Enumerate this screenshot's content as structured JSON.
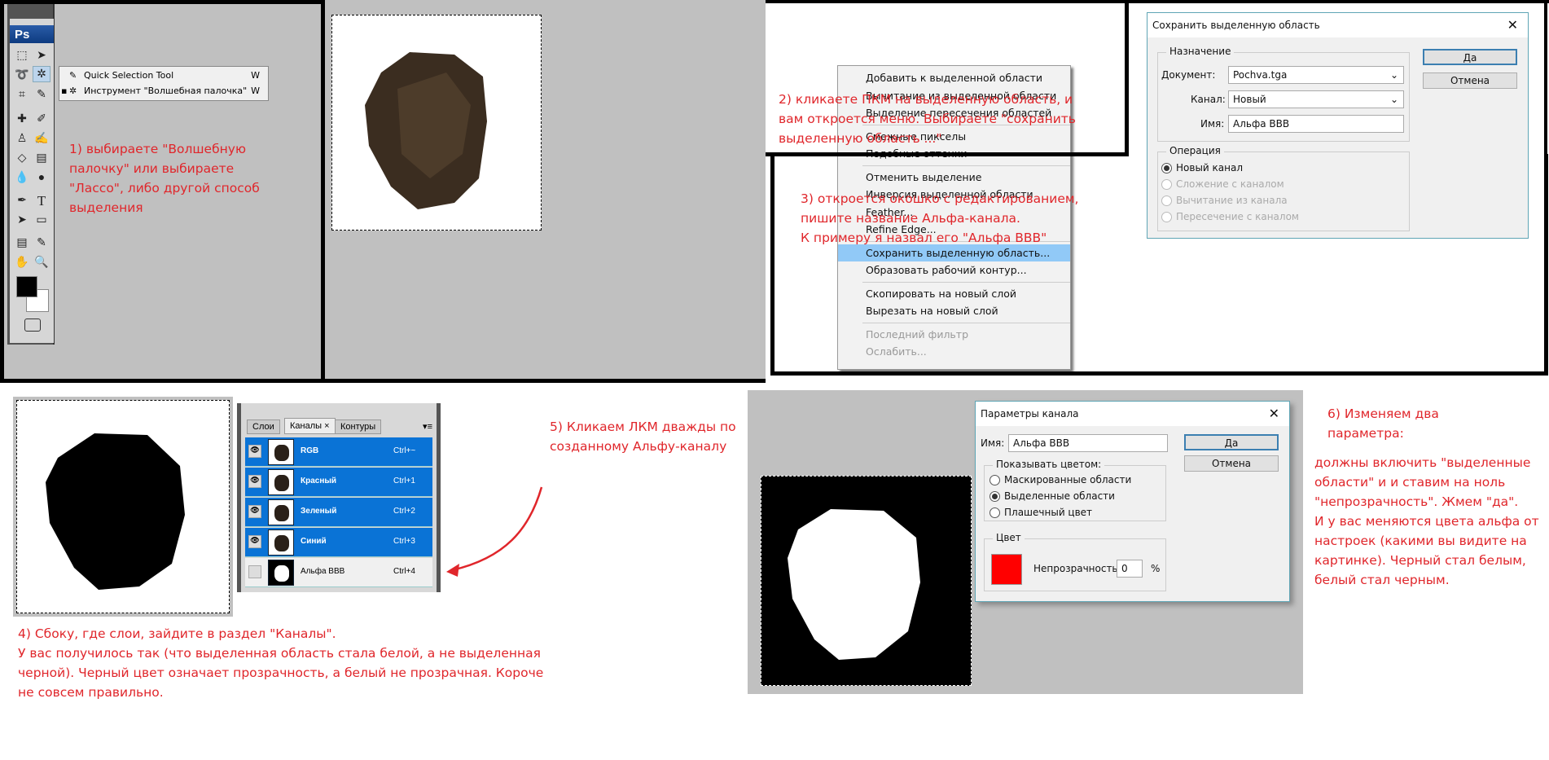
{
  "step1": {
    "ps_logo": "Ps",
    "tool_menu": [
      {
        "label": "Quick Selection Tool",
        "key": "W",
        "active": false
      },
      {
        "label": "Инструмент \"Волшебная палочка\"",
        "key": "W",
        "active": true
      }
    ],
    "note": [
      "1) выбираете \"Волшебную",
      "палочку\" или выбираете",
      "\"Лассо\", либо другой способ",
      "выделения"
    ]
  },
  "step2": {
    "menu": [
      [
        "Добавить к выделенной области",
        "Вычитание из выделенной области",
        "Выделение пересечения областей"
      ],
      [
        "Смежные пикселы",
        "Подобные оттенки"
      ],
      [
        "Отменить выделение",
        "Инверсия выделенной области",
        "Feather...",
        "Refine Edge..."
      ],
      [
        "Сохранить выделенную область...",
        "Образовать рабочий контур..."
      ],
      [
        "Скопировать на новый слой",
        "Вырезать на новый слой"
      ],
      [
        "Последний фильтр",
        "Ослабить..."
      ]
    ],
    "highlighted": "Сохранить выделенную область...",
    "disabled": [
      "Последний фильтр",
      "Ослабить..."
    ],
    "note": [
      "2) кликаете ПКМ на выделенную область, и",
      "вам откроется меню. Выбираете \"сохранить",
      "выделенную область ...\""
    ]
  },
  "step3": {
    "note": [
      "3) откроется окошко с редактированием,",
      "пишите название Альфа-канала.",
      "К примеру я назвал его \"Альфа BBB\""
    ],
    "dialog": {
      "title": "Сохранить выделенную область",
      "dest_legend": "Назначение",
      "doc_label": "Документ:",
      "doc_value": "Pochva.tga",
      "channel_label": "Канал:",
      "channel_value": "Новый",
      "name_label": "Имя:",
      "name_value": "Альфа BBB",
      "op_legend": "Операция",
      "ops": [
        "Новый канал",
        "Сложение с каналом",
        "Вычитание из канала",
        "Пересечение с каналом"
      ],
      "ok": "Да",
      "cancel": "Отмена"
    }
  },
  "step4": {
    "note": [
      "4) Сбоку, где слои, зайдите в раздел \"Каналы\".",
      "У вас получилось так (что выделенная область стала белой, а не выделенная",
      "черной). Черный цвет означает прозрачность, а белый не прозрачная. Короче",
      "не совсем правильно."
    ],
    "tabs": [
      "Слои",
      "Каналы ×",
      "Контуры"
    ],
    "channels": [
      {
        "name": "RGB",
        "shortcut": "Ctrl+~"
      },
      {
        "name": "Красный",
        "shortcut": "Ctrl+1"
      },
      {
        "name": "Зеленый",
        "shortcut": "Ctrl+2"
      },
      {
        "name": "Синий",
        "shortcut": "Ctrl+3"
      },
      {
        "name": "Альфа BBB",
        "shortcut": "Ctrl+4"
      }
    ]
  },
  "step5": {
    "note": [
      "5) Кликаем ЛКМ дважды по",
      "созданному Альфу-каналу"
    ]
  },
  "step6": {
    "note_head": [
      "6) Изменяем два",
      "параметра:"
    ],
    "note": [
      "должны включить \"выделенные",
      "области\" и и ставим на ноль",
      "\"непрозрачность\". Жмем \"да\".",
      "И у вас меняются цвета альфа от",
      "настроек (какими вы видите на",
      "картинке). Черный стал белым,",
      "белый стал черным."
    ],
    "dialog": {
      "title": "Параметры канала",
      "name_label": "Имя:",
      "name_value": "Альфа BBB",
      "show_legend": "Показывать цветом:",
      "options": [
        "Маскированные области",
        "Выделенные области",
        "Плашечный цвет"
      ],
      "color_legend": "Цвет",
      "color": "#ff0000",
      "opacity_label": "Непрозрачность:",
      "opacity_value": "0",
      "percent": "%",
      "ok": "Да",
      "cancel": "Отмена"
    }
  }
}
